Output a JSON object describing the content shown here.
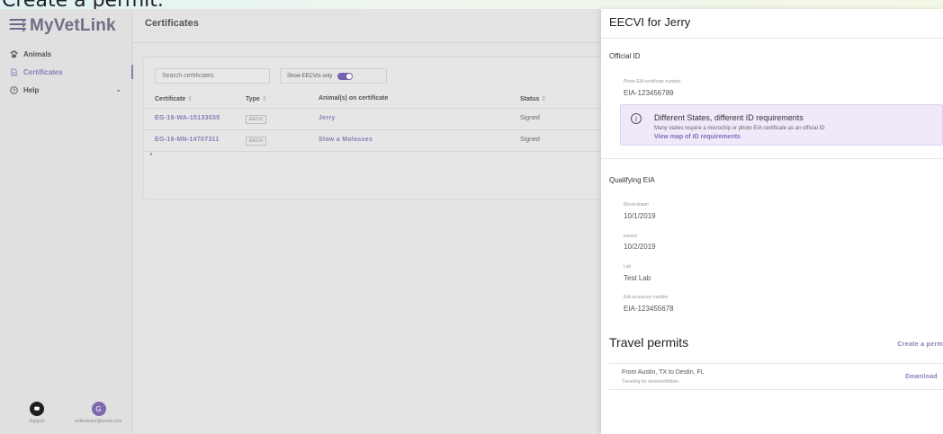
{
  "caption": {
    "text": "Create a permit."
  },
  "app": {
    "name": "MyVetLink"
  },
  "sidebar": {
    "items": [
      {
        "label": "Animals",
        "icon": "paw-icon"
      },
      {
        "label": "Certificates",
        "icon": "document-icon",
        "active": true
      },
      {
        "label": "Help",
        "icon": "help-icon"
      }
    ],
    "footer": {
      "support_label": "Support",
      "avatar_initial": "G",
      "user_email": "evltestuser@email.com"
    }
  },
  "main": {
    "title": "Certificates",
    "search_placeholder": "Search certificates",
    "toggle_label": "Show EECVIs only",
    "columns": [
      "Certificate",
      "Type",
      "Animal(s) on certificate",
      "Status"
    ],
    "rows": [
      {
        "certificate": "EG-19-WA-15133035",
        "type": "EECVI",
        "animals": "Jerry",
        "status": "Signed"
      },
      {
        "certificate": "EG-19-MN-14707311",
        "type": "EECVI",
        "animals": "Slow a Molasses",
        "status": "Signed"
      }
    ]
  },
  "drawer": {
    "title": "EECVI for Jerry",
    "official_id": {
      "heading": "Official ID",
      "label": "Photo EIA certificate number",
      "value": "EIA-123456789"
    },
    "notice": {
      "title": "Different States, different ID requirements",
      "body": "Many states require a microchip or photo EIA certificate as an official ID",
      "link": "View map of ID requirements"
    },
    "qualifying_eia": {
      "heading": "Qualifying EIA",
      "blood_drawn_label": "Blood drawn",
      "blood_drawn": "10/1/2019",
      "issued_label": "Issued",
      "issued": "10/2/2019",
      "lab_label": "Lab",
      "lab": "Test Lab",
      "accession_label": "EIA accession number",
      "accession": "EIA-123455678"
    },
    "travel_permits": {
      "heading": "Travel permits",
      "create_label": "Create a perm",
      "items": [
        {
          "route": "From Austin, TX to Destin, FL",
          "purpose": "Traveling for show/exhibition",
          "download_label": "Download"
        }
      ]
    }
  }
}
